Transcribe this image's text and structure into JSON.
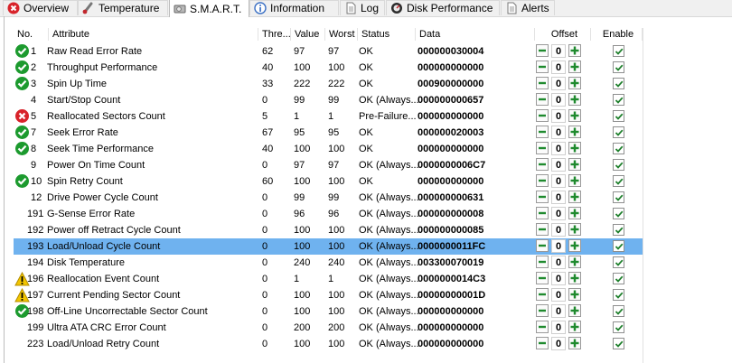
{
  "tabs": [
    {
      "label": "Overview"
    },
    {
      "label": "Temperature"
    },
    {
      "label": "S.M.A.R.T."
    },
    {
      "label": "Information"
    },
    {
      "label": "Log"
    },
    {
      "label": "Disk Performance"
    },
    {
      "label": "Alerts"
    }
  ],
  "columns": [
    "No.",
    "Attribute",
    "Thre...",
    "Value",
    "Worst",
    "Status",
    "Data",
    "Offset",
    "Enable"
  ],
  "rows": [
    {
      "no": "1",
      "attr": "Raw Read Error Rate",
      "thre": "62",
      "value": "97",
      "worst": "97",
      "status": "OK",
      "data": "000000030004",
      "offset": "0",
      "icon": "ok"
    },
    {
      "no": "2",
      "attr": "Throughput Performance",
      "thre": "40",
      "value": "100",
      "worst": "100",
      "status": "OK",
      "data": "000000000000",
      "offset": "0",
      "icon": "ok"
    },
    {
      "no": "3",
      "attr": "Spin Up Time",
      "thre": "33",
      "value": "222",
      "worst": "222",
      "status": "OK",
      "data": "000900000000",
      "offset": "0",
      "icon": "ok"
    },
    {
      "no": "4",
      "attr": "Start/Stop Count",
      "thre": "0",
      "value": "99",
      "worst": "99",
      "status": "OK (Always...",
      "data": "000000000657",
      "offset": "0",
      "icon": "none"
    },
    {
      "no": "5",
      "attr": "Reallocated Sectors Count",
      "thre": "5",
      "value": "1",
      "worst": "1",
      "status": "Pre-Failure...",
      "data": "000000000000",
      "offset": "0",
      "icon": "bad"
    },
    {
      "no": "7",
      "attr": "Seek Error Rate",
      "thre": "67",
      "value": "95",
      "worst": "95",
      "status": "OK",
      "data": "000000020003",
      "offset": "0",
      "icon": "ok"
    },
    {
      "no": "8",
      "attr": "Seek Time Performance",
      "thre": "40",
      "value": "100",
      "worst": "100",
      "status": "OK",
      "data": "000000000000",
      "offset": "0",
      "icon": "ok"
    },
    {
      "no": "9",
      "attr": "Power On Time Count",
      "thre": "0",
      "value": "97",
      "worst": "97",
      "status": "OK (Always...",
      "data": "0000000006C7",
      "offset": "0",
      "icon": "none"
    },
    {
      "no": "10",
      "attr": "Spin Retry Count",
      "thre": "60",
      "value": "100",
      "worst": "100",
      "status": "OK",
      "data": "000000000000",
      "offset": "0",
      "icon": "ok"
    },
    {
      "no": "12",
      "attr": "Drive Power Cycle Count",
      "thre": "0",
      "value": "99",
      "worst": "99",
      "status": "OK (Always...",
      "data": "000000000631",
      "offset": "0",
      "icon": "none"
    },
    {
      "no": "191",
      "attr": "G-Sense Error Rate",
      "thre": "0",
      "value": "96",
      "worst": "96",
      "status": "OK (Always...",
      "data": "000000000008",
      "offset": "0",
      "icon": "none"
    },
    {
      "no": "192",
      "attr": "Power off Retract Cycle Count",
      "thre": "0",
      "value": "100",
      "worst": "100",
      "status": "OK (Always...",
      "data": "000000000085",
      "offset": "0",
      "icon": "none"
    },
    {
      "no": "193",
      "attr": "Load/Unload Cycle Count",
      "thre": "0",
      "value": "100",
      "worst": "100",
      "status": "OK (Always...",
      "data": "0000000011FC",
      "offset": "0",
      "icon": "none",
      "selected": true
    },
    {
      "no": "194",
      "attr": "Disk Temperature",
      "thre": "0",
      "value": "240",
      "worst": "240",
      "status": "OK (Always...",
      "data": "003300070019",
      "offset": "0",
      "icon": "none"
    },
    {
      "no": "196",
      "attr": "Reallocation Event Count",
      "thre": "0",
      "value": "1",
      "worst": "1",
      "status": "OK (Always...",
      "data": "0000000014C3",
      "offset": "0",
      "icon": "warn"
    },
    {
      "no": "197",
      "attr": "Current Pending Sector Count",
      "thre": "0",
      "value": "100",
      "worst": "100",
      "status": "OK (Always...",
      "data": "00000000001D",
      "offset": "0",
      "icon": "warn"
    },
    {
      "no": "198",
      "attr": "Off-Line Uncorrectable Sector Count",
      "thre": "0",
      "value": "100",
      "worst": "100",
      "status": "OK (Always...",
      "data": "000000000000",
      "offset": "0",
      "icon": "ok"
    },
    {
      "no": "199",
      "attr": "Ultra ATA CRC Error Count",
      "thre": "0",
      "value": "200",
      "worst": "200",
      "status": "OK (Always...",
      "data": "000000000000",
      "offset": "0",
      "icon": "none"
    },
    {
      "no": "223",
      "attr": "Load/Unload Retry Count",
      "thre": "0",
      "value": "100",
      "worst": "100",
      "status": "OK (Always...",
      "data": "000000000000",
      "offset": "0",
      "icon": "none"
    }
  ],
  "colors": {
    "selection": "#6fb2ef",
    "ok": "#1c9a2e",
    "bad": "#d8232a",
    "warn": "#f2c500",
    "stepper": "#1f8a2e"
  }
}
